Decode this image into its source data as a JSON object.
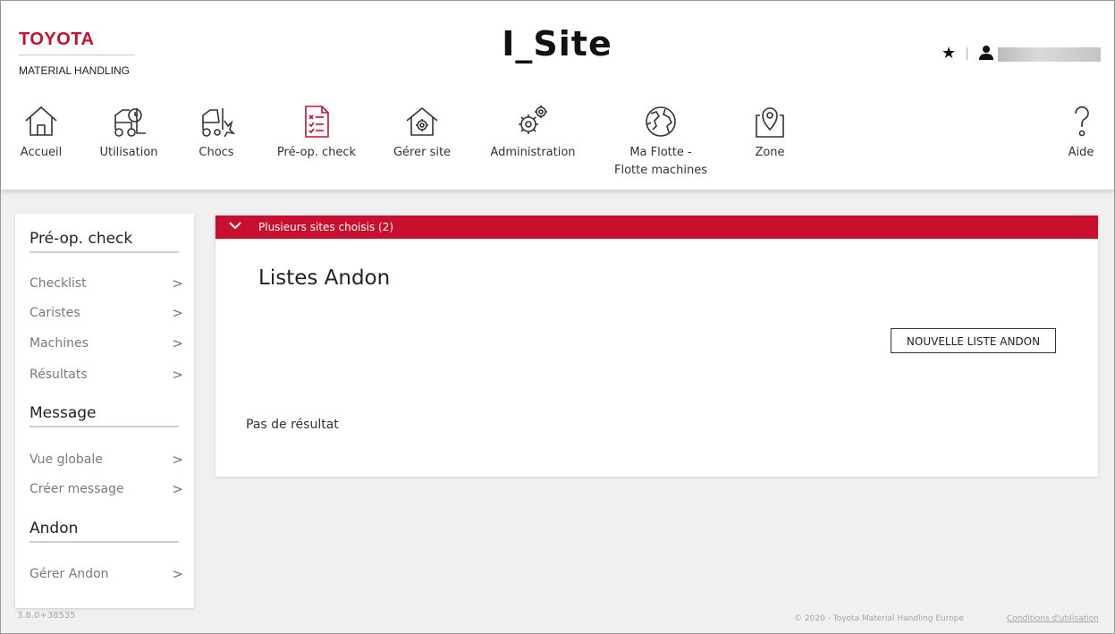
{
  "header": {
    "logo": {
      "brand": "TOYOTA",
      "subtitle": "MATERIAL HANDLING"
    },
    "app_title": "I_Site",
    "favorites_icon": "star-icon",
    "user_icon": "user-icon"
  },
  "nav": {
    "items": [
      {
        "label": "Accueil",
        "icon": "home-icon",
        "active": false
      },
      {
        "label": "Utilisation",
        "icon": "forklift-clock-icon",
        "active": false
      },
      {
        "label": "Chocs",
        "icon": "forklift-impact-icon",
        "active": false
      },
      {
        "label": "Pré-op. check",
        "icon": "checklist-icon",
        "active": true
      },
      {
        "label": "Gérer site",
        "icon": "house-gear-icon",
        "active": false
      },
      {
        "label": "Administration",
        "icon": "gears-icon",
        "active": false
      },
      {
        "label": "Ma Flotte -",
        "label2": "Flotte machines",
        "icon": "globe-icon",
        "active": false
      },
      {
        "label": "Zone",
        "icon": "map-pin-icon",
        "active": false
      },
      {
        "label": "Aide",
        "icon": "help-icon",
        "active": false
      }
    ]
  },
  "sidebar": {
    "sections": [
      {
        "heading": "Pré-op. check",
        "links": [
          "Checklist",
          "Caristes",
          "Machines",
          "Résultats"
        ]
      },
      {
        "heading": "Message",
        "links": [
          "Vue globale",
          "Créer message"
        ]
      },
      {
        "heading": "Andon",
        "links": [
          "Gérer Andon"
        ]
      }
    ]
  },
  "main": {
    "site_bar": "Plusieurs sites choisis (2)",
    "title": "Listes Andon",
    "new_button": "NOUVELLE LISTE ANDON",
    "empty_text": "Pas de résultat"
  },
  "footer": {
    "version": "3.8.0+38535",
    "copyright": "© 2020 - Toyota Material Handling Europe",
    "terms": "Conditions d'utilisation"
  },
  "colors": {
    "accent": "#c8102e",
    "background": "#f0f0f0",
    "panel": "#ffffff"
  }
}
